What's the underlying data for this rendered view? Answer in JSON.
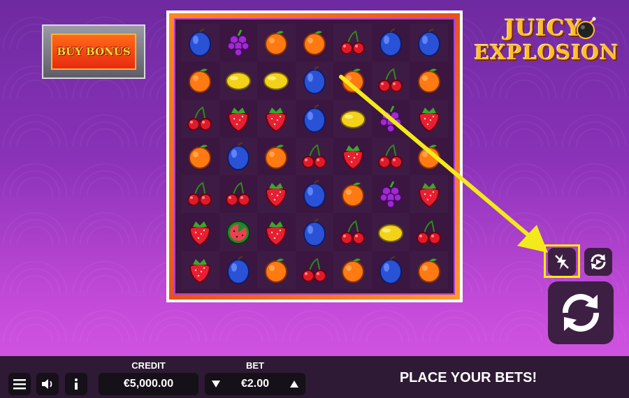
{
  "game": {
    "title_line1": "JUICY",
    "title_line2": "EXPLOSION",
    "buy_bonus_label": "BUY BONUS",
    "status_message": "PLACE YOUR BETS!"
  },
  "grid": [
    [
      "plum",
      "grapes",
      "orange",
      "orange",
      "cherries",
      "plum",
      "plum"
    ],
    [
      "orange",
      "lemon",
      "lemon",
      "plum",
      "orange",
      "cherries",
      "orange"
    ],
    [
      "cherries",
      "strawberry",
      "strawberry",
      "plum",
      "lemon",
      "grapes",
      "strawberry"
    ],
    [
      "orange",
      "plum",
      "orange",
      "cherries",
      "strawberry",
      "cherries",
      "orange"
    ],
    [
      "cherries",
      "cherries",
      "strawberry",
      "plum",
      "orange",
      "grapes",
      "strawberry"
    ],
    [
      "strawberry",
      "watermelon",
      "strawberry",
      "plum",
      "cherries",
      "lemon",
      "cherries"
    ],
    [
      "strawberry",
      "plum",
      "orange",
      "cherries",
      "orange",
      "plum",
      "orange"
    ]
  ],
  "bottom_bar": {
    "credit_label": "CREDIT",
    "credit_value": "€5,000.00",
    "bet_label": "BET",
    "bet_value": "€2.00"
  },
  "controls": {
    "menu_icon": "hamburger-icon",
    "sound_icon": "speaker-icon",
    "info_icon": "info-icon",
    "turbo_icon": "turbo-lightning-icon",
    "autoplay_icon": "autoplay-icon",
    "spin_icon": "spin-arrows-icon"
  },
  "colors": {
    "highlight": "#ffee00",
    "button_bg": "#3e1f44",
    "frame_orange": "#ff8a1a"
  }
}
